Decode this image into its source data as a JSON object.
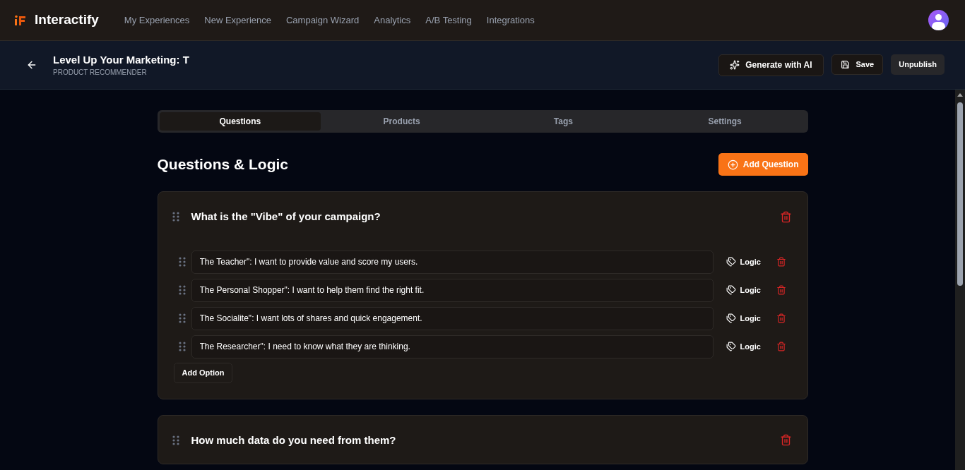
{
  "brand": "Interactify",
  "nav": [
    "My Experiences",
    "New Experience",
    "Campaign Wizard",
    "Analytics",
    "A/B Testing",
    "Integrations"
  ],
  "page": {
    "title": "Level Up Your Marketing: T",
    "subtitle": "PRODUCT RECOMMENDER"
  },
  "actions": {
    "generate": "Generate with AI",
    "save": "Save",
    "unpublish": "Unpublish"
  },
  "tabs": [
    {
      "label": "Questions",
      "selected": true
    },
    {
      "label": "Products",
      "selected": false
    },
    {
      "label": "Tags",
      "selected": false
    },
    {
      "label": "Settings",
      "selected": false
    }
  ],
  "section": {
    "title": "Questions & Logic",
    "add_button": "Add Question"
  },
  "questions": [
    {
      "text": "What is the \"Vibe\" of your campaign?",
      "options": [
        {
          "value": "The Teacher\": I want to provide value and score my users.",
          "logic": "Logic"
        },
        {
          "value": "The Personal Shopper\": I want to help them find the right fit.",
          "logic": "Logic"
        },
        {
          "value": "The Socialite\": I want lots of shares and quick engagement.",
          "logic": "Logic"
        },
        {
          "value": "The Researcher\": I need to know what they are thinking.",
          "logic": "Logic"
        }
      ],
      "add_option": "Add Option"
    },
    {
      "text": "How much data do you need from them?"
    }
  ]
}
